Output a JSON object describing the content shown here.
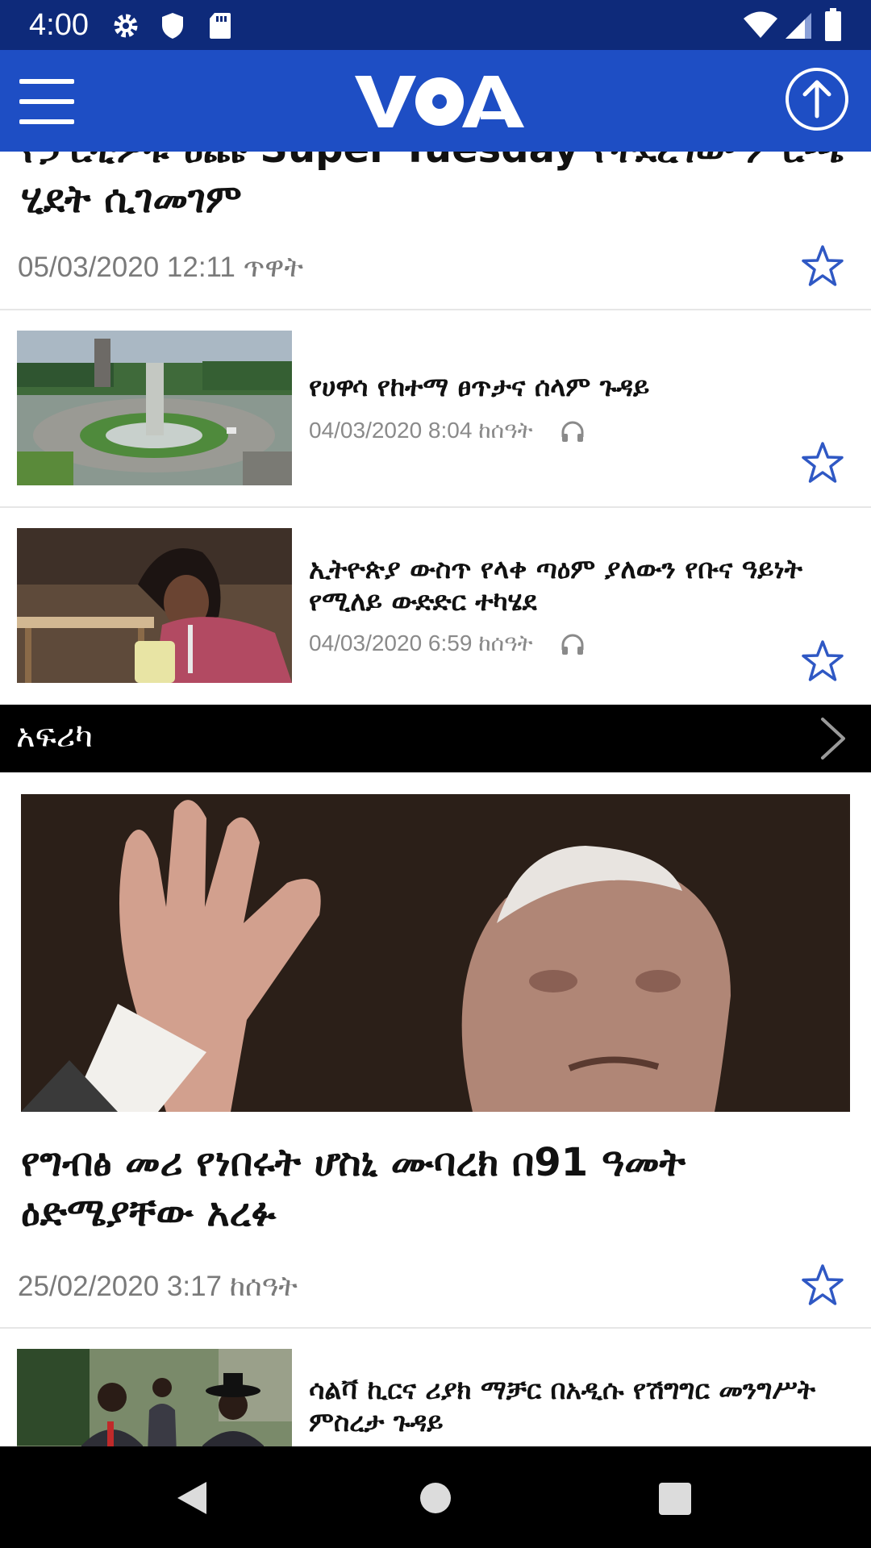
{
  "status_bar": {
    "time": "4:00",
    "icons": [
      "gear-icon",
      "shield-icon",
      "sd-card-icon",
      "wifi-icon",
      "signal-icon",
      "battery-icon"
    ]
  },
  "app_bar": {
    "menu_icon": "menu-icon",
    "logo_text": "VOA",
    "scroll_top_icon": "arrow-up-circle-icon",
    "background": "#1e4ec4"
  },
  "top_story": {
    "headline": "የፓርቲዎቹ ዕጩ Super Tuesday የተደረገው ምርጫ ሂደት ሲገመገም",
    "date": "05/03/2020 12:11 ጥዋት"
  },
  "items": [
    {
      "title": "የሀዋሳ የከተማ ፀጥታና ሰላም ጉዳይ",
      "meta": "04/03/2020 8:04 ከሰዓት",
      "has_audio": true
    },
    {
      "title": "ኢትዮጵያ ውስጥ የላቀ ጣዕም ያለውን የቡና ዓይነት የሚለይ ውድድር ተካሄደ",
      "meta": "04/03/2020 6:59 ከሰዓት",
      "has_audio": true
    }
  ],
  "section": {
    "title": "አፍሪካ",
    "chevron_icon": "chevron-right-icon"
  },
  "featured": {
    "title": "የግብፅ መሪ የነበሩት ሆስኒ ሙባረክ በ91 ዓመት ዕድሜያቸው አረፉ",
    "date": "25/02/2020 3:17 ከሰዓት"
  },
  "next_item": {
    "title": "ሳልቫ ኪርና ሪያክ ማቻር በአዲሱ የሽግግር መንግሥት ምስረታ ጉዳይ"
  },
  "colors": {
    "accent_blue": "#1e4ec4",
    "status_blue": "#0e2a7a",
    "star_blue": "#2f58c4",
    "meta_gray": "#8a8a8a"
  }
}
